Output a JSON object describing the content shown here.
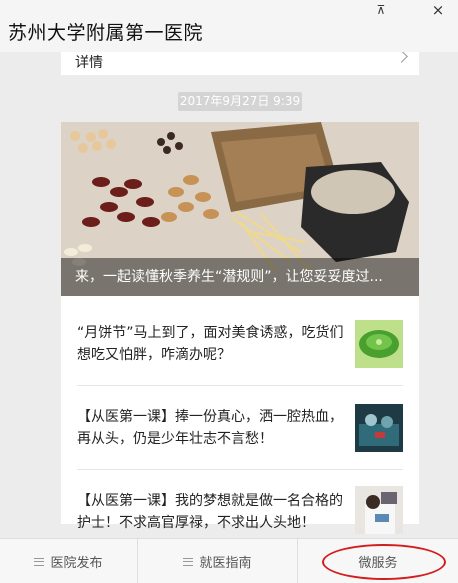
{
  "window": {
    "title": "苏州大学附属第一医院",
    "pin_glyph": "⊼",
    "close_glyph": "×"
  },
  "detail_card": {
    "label": "详情"
  },
  "message": {
    "timestamp": "2017年9月27日 9:39",
    "cover_caption": "来，一起读懂秋季养生“潜规则”，让您妥妥度过..."
  },
  "articles": [
    {
      "title": "“月饼节”马上到了，面对美食诱惑，吃货们想吃又怕胖，咋滴办呢？",
      "thumb": "mooncake-thumbnail"
    },
    {
      "title": "【从医第一课】捧一份真心，洒一腔热血，再从头，仍是少年壮志不言愁！",
      "thumb": "surgery-thumbnail"
    },
    {
      "title": "【从医第一课】我的梦想就是做一名合格的护士！不求高官厚禄，不求出人头地！",
      "thumb": "nurse-thumbnail"
    }
  ],
  "bottom_nav": {
    "items": [
      {
        "label": "医院发布",
        "icon": "menu-icon"
      },
      {
        "label": "就医指南",
        "icon": "menu-icon"
      },
      {
        "label": "微服务"
      }
    ]
  },
  "colors": {
    "annotation_circle": "#d21e1e",
    "timestamp_bg": "#d4d4d4",
    "background": "#ececec"
  }
}
